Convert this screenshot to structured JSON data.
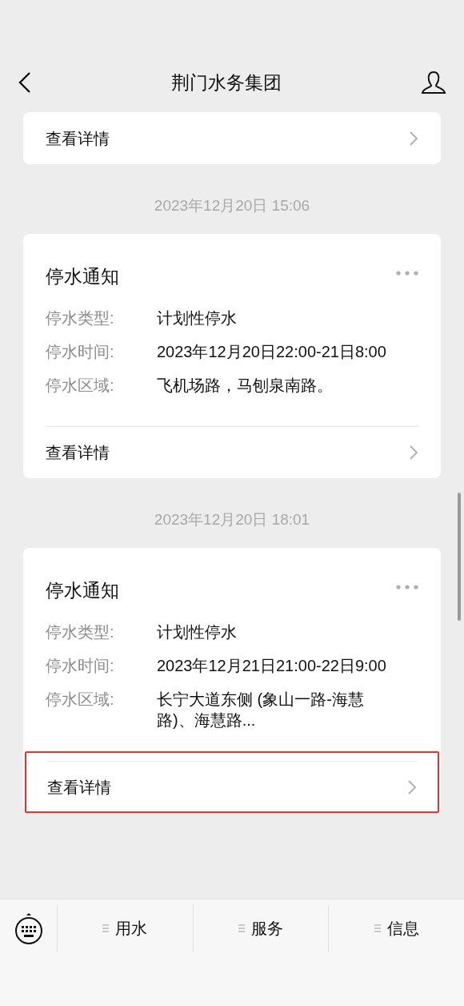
{
  "header": {
    "title": "荆门水务集团"
  },
  "messages": [
    {
      "kind": "partial",
      "detail": {
        "label": "查看详情",
        "highlighted": false
      }
    },
    {
      "kind": "notice",
      "time": "2023年12月20日 15:06",
      "title": "停水通知",
      "fields": [
        {
          "label": "停水类型:",
          "value": "计划性停水"
        },
        {
          "label": "停水时间:",
          "value": "2023年12月20日22:00-21日8:00"
        },
        {
          "label": "停水区域:",
          "value": "飞机场路，马刨泉南路。"
        }
      ],
      "detail": {
        "label": "查看详情",
        "highlighted": false
      }
    },
    {
      "kind": "notice",
      "time": "2023年12月20日 18:01",
      "title": "停水通知",
      "fields": [
        {
          "label": "停水类型:",
          "value": "计划性停水"
        },
        {
          "label": "停水时间:",
          "value": "2023年12月21日21:00-22日9:00"
        },
        {
          "label": "停水区域:",
          "value": "长宁大道东侧 (象山一路-海慧路)、海慧路..."
        }
      ],
      "detail": {
        "label": "查看详情",
        "highlighted": true
      }
    }
  ],
  "menu": [
    {
      "label": "用水"
    },
    {
      "label": "服务"
    },
    {
      "label": "信息"
    }
  ]
}
